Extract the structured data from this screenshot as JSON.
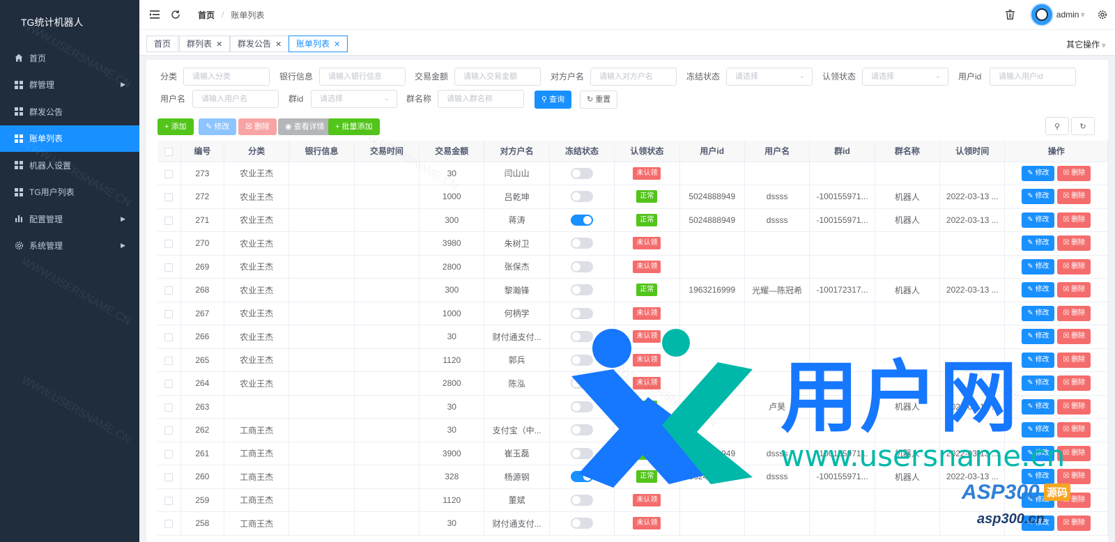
{
  "app": {
    "title": "TG统计机器人"
  },
  "sidebar": {
    "items": [
      {
        "label": "首页",
        "icon": "home-icon",
        "has_arrow": false,
        "active": false
      },
      {
        "label": "群管理",
        "icon": "grid-icon",
        "has_arrow": true,
        "active": false
      },
      {
        "label": "群发公告",
        "icon": "grid-icon",
        "has_arrow": false,
        "active": false
      },
      {
        "label": "账单列表",
        "icon": "grid-icon",
        "has_arrow": false,
        "active": true
      },
      {
        "label": "机器人设置",
        "icon": "grid-icon",
        "has_arrow": false,
        "active": false
      },
      {
        "label": "TG用户列表",
        "icon": "grid-icon",
        "has_arrow": false,
        "active": false
      },
      {
        "label": "配置管理",
        "icon": "chart-icon",
        "has_arrow": true,
        "active": false
      },
      {
        "label": "系统管理",
        "icon": "gear-icon",
        "has_arrow": true,
        "active": false
      }
    ]
  },
  "navbar": {
    "breadcrumb_home": "首页",
    "breadcrumb_sep": "/",
    "breadcrumb_current": "账单列表",
    "user_name": "admin"
  },
  "tags": {
    "items": [
      {
        "label": "首页",
        "closable": false,
        "active": false
      },
      {
        "label": "群列表",
        "closable": true,
        "active": false
      },
      {
        "label": "群发公告",
        "closable": true,
        "active": false
      },
      {
        "label": "账单列表",
        "closable": true,
        "active": true
      }
    ],
    "other_ops": "其它操作"
  },
  "filters": {
    "category_label": "分类",
    "category_placeholder": "请输入分类",
    "bank_label": "银行信息",
    "bank_placeholder": "请输入银行信息",
    "amount_label": "交易金额",
    "amount_placeholder": "请输入交易金额",
    "counterparty_label": "对方户名",
    "counterparty_placeholder": "请输入对方户名",
    "freeze_label": "冻结状态",
    "freeze_placeholder": "请选择",
    "claim_label": "认领状态",
    "claim_placeholder": "请选择",
    "userid_label": "用户id",
    "userid_placeholder": "请输入用户id",
    "username_label": "用户名",
    "username_placeholder": "请输入用户名",
    "groupid_label": "群id",
    "groupid_placeholder": "请选择",
    "groupname_label": "群名称",
    "groupname_placeholder": "请输入群名称",
    "search_label": "查询",
    "reset_label": "重置"
  },
  "toolbar": {
    "add_label": "添加",
    "edit_label": "修改",
    "delete_label": "删除",
    "detail_label": "查看详情",
    "batch_add_label": "批量添加"
  },
  "table": {
    "columns": [
      "编号",
      "分类",
      "银行信息",
      "交易时间",
      "交易金额",
      "对方户名",
      "冻结状态",
      "认领状态",
      "用户id",
      "用户名",
      "群id",
      "群名称",
      "认领时间",
      "操作"
    ],
    "edit_label": "修改",
    "delete_label": "删除",
    "status_ok": "正常",
    "status_unclaimed": "未认领",
    "rows": [
      {
        "id": "273",
        "category": "农业王杰",
        "bank": "",
        "time": "",
        "amount": "30",
        "counterparty": "闫山山",
        "frozen": false,
        "status": "未认领",
        "user_id": "",
        "user_name": "",
        "group_id": "",
        "group_name": "",
        "claim_time": ""
      },
      {
        "id": "272",
        "category": "农业王杰",
        "bank": "",
        "time": "",
        "amount": "1000",
        "counterparty": "吕乾坤",
        "frozen": false,
        "status": "正常",
        "user_id": "5024888949",
        "user_name": "dssss",
        "group_id": "-100155971...",
        "group_name": "机器人",
        "claim_time": "2022-03-13 ..."
      },
      {
        "id": "271",
        "category": "农业王杰",
        "bank": "",
        "time": "",
        "amount": "300",
        "counterparty": "蒋涛",
        "frozen": true,
        "status": "正常",
        "user_id": "5024888949",
        "user_name": "dssss",
        "group_id": "-100155971...",
        "group_name": "机器人",
        "claim_time": "2022-03-13 ..."
      },
      {
        "id": "270",
        "category": "农业王杰",
        "bank": "",
        "time": "",
        "amount": "3980",
        "counterparty": "朱树卫",
        "frozen": false,
        "status": "未认领",
        "user_id": "",
        "user_name": "",
        "group_id": "",
        "group_name": "",
        "claim_time": ""
      },
      {
        "id": "269",
        "category": "农业王杰",
        "bank": "",
        "time": "",
        "amount": "2800",
        "counterparty": "张保杰",
        "frozen": false,
        "status": "未认领",
        "user_id": "",
        "user_name": "",
        "group_id": "",
        "group_name": "",
        "claim_time": ""
      },
      {
        "id": "268",
        "category": "农业王杰",
        "bank": "",
        "time": "",
        "amount": "300",
        "counterparty": "黎瀚锋",
        "frozen": false,
        "status": "正常",
        "user_id": "1963216999",
        "user_name": "光耀—陈冠希",
        "group_id": "-100172317...",
        "group_name": "机器人",
        "claim_time": "2022-03-13 ..."
      },
      {
        "id": "267",
        "category": "农业王杰",
        "bank": "",
        "time": "",
        "amount": "1000",
        "counterparty": "何柄学",
        "frozen": false,
        "status": "未认领",
        "user_id": "",
        "user_name": "",
        "group_id": "",
        "group_name": "",
        "claim_time": ""
      },
      {
        "id": "266",
        "category": "农业王杰",
        "bank": "",
        "time": "",
        "amount": "30",
        "counterparty": "财付通支付...",
        "frozen": false,
        "status": "未认领",
        "user_id": "",
        "user_name": "",
        "group_id": "",
        "group_name": "",
        "claim_time": ""
      },
      {
        "id": "265",
        "category": "农业王杰",
        "bank": "",
        "time": "",
        "amount": "1120",
        "counterparty": "郭兵",
        "frozen": false,
        "status": "未认领",
        "user_id": "",
        "user_name": "",
        "group_id": "",
        "group_name": "",
        "claim_time": ""
      },
      {
        "id": "264",
        "category": "农业王杰",
        "bank": "",
        "time": "",
        "amount": "2800",
        "counterparty": "陈泓",
        "frozen": false,
        "status": "未认领",
        "user_id": "",
        "user_name": "",
        "group_id": "",
        "group_name": "",
        "claim_time": ""
      },
      {
        "id": "263",
        "category": "",
        "bank": "",
        "time": "",
        "amount": "30",
        "counterparty": "",
        "frozen": false,
        "status": "正常",
        "user_id": "",
        "user_name": "卢昊",
        "group_id": "",
        "group_name": "机器人",
        "claim_time": "2022-03-13 ..."
      },
      {
        "id": "262",
        "category": "工商王杰",
        "bank": "",
        "time": "",
        "amount": "30",
        "counterparty": "支付宝（中...",
        "frozen": false,
        "status": "未认领",
        "user_id": "",
        "user_name": "",
        "group_id": "",
        "group_name": "",
        "claim_time": ""
      },
      {
        "id": "261",
        "category": "工商王杰",
        "bank": "",
        "time": "",
        "amount": "3900",
        "counterparty": "崔玉磊",
        "frozen": false,
        "status": "正常",
        "user_id": "5024888949",
        "user_name": "dssss",
        "group_id": "-100155971...",
        "group_name": "机器人",
        "claim_time": "2022-03-13 ..."
      },
      {
        "id": "260",
        "category": "工商王杰",
        "bank": "",
        "time": "",
        "amount": "328",
        "counterparty": "杨源钢",
        "frozen": true,
        "status": "正常",
        "user_id": "5024888949",
        "user_name": "dssss",
        "group_id": "-100155971...",
        "group_name": "机器人",
        "claim_time": "2022-03-13 ..."
      },
      {
        "id": "259",
        "category": "工商王杰",
        "bank": "",
        "time": "",
        "amount": "1120",
        "counterparty": "董斌",
        "frozen": false,
        "status": "未认领",
        "user_id": "",
        "user_name": "",
        "group_id": "",
        "group_name": "",
        "claim_time": ""
      },
      {
        "id": "258",
        "category": "工商王杰",
        "bank": "",
        "time": "",
        "amount": "30",
        "counterparty": "财付通支付...",
        "frozen": false,
        "status": "未认领",
        "user_id": "",
        "user_name": "",
        "group_id": "",
        "group_name": "",
        "claim_time": ""
      }
    ]
  },
  "watermarks": {
    "text": "WWW.USERSNAME.CN",
    "logo_cn": "用户网",
    "logo_url": "www.usersname.cn",
    "asp_main": "ASP300",
    "asp_tag": "源码",
    "asp_sub": "asp300.cn"
  },
  "colors": {
    "sidebar_bg": "#1f2d3d",
    "primary": "#1890ff",
    "success": "#52c41a",
    "danger": "#f56c6c"
  }
}
